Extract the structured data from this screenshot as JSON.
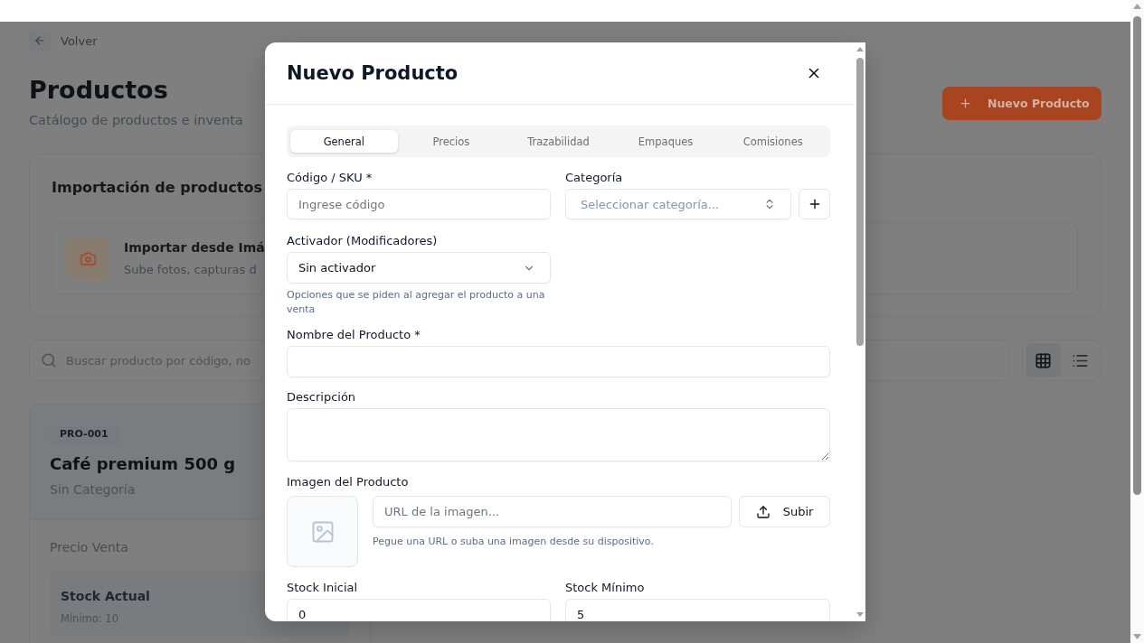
{
  "back_link": {
    "label": "Volver"
  },
  "page_header": {
    "title": "Productos",
    "subtitle": "Catálogo de productos e inventa",
    "new_button": "Nuevo Producto"
  },
  "import_panel": {
    "title": "Importación de productos",
    "options": [
      {
        "title": "Importar desde Imá",
        "description": "Sube fotos, capturas d"
      }
    ]
  },
  "search": {
    "placeholder": "Buscar producto por código, no"
  },
  "view_toggle": [
    {
      "kind": "grid",
      "selected": true
    },
    {
      "kind": "list",
      "selected": false
    }
  ],
  "products": [
    {
      "code": "PRO-001",
      "name": "Café premium 500 g",
      "category": "Sin Categoría",
      "price_label": "Precio Venta",
      "stock_label": "Stock Actual",
      "minimum": "Mínimo: 10"
    }
  ],
  "modal": {
    "title": "Nuevo Producto",
    "tabs": [
      {
        "label": "General",
        "selected": true
      },
      {
        "label": "Precios",
        "selected": false
      },
      {
        "label": "Trazabilidad",
        "selected": false
      },
      {
        "label": "Empaques",
        "selected": false
      },
      {
        "label": "Comisiones",
        "selected": false
      }
    ],
    "form": {
      "code": {
        "label": "Código / SKU *",
        "placeholder": "Ingrese código"
      },
      "category": {
        "label": "Categoría",
        "placeholder": "Seleccionar categoría..."
      },
      "trigger": {
        "label": "Activador (Modificadores)",
        "value": "Sin activador",
        "help": "Opciones que se piden al agregar el producto a una venta"
      },
      "name": {
        "label": "Nombre del Producto *"
      },
      "description": {
        "label": "Descripción"
      },
      "image": {
        "label": "Imagen del Producto",
        "placeholder": "URL de la imagen...",
        "upload_button": "Subir",
        "help": "Pegue una URL o suba una imagen desde su dispositivo."
      },
      "stock": [
        {
          "label": "Stock Inicial",
          "value": "0"
        },
        {
          "label": "Stock Mínimo",
          "value": "5"
        }
      ]
    }
  }
}
